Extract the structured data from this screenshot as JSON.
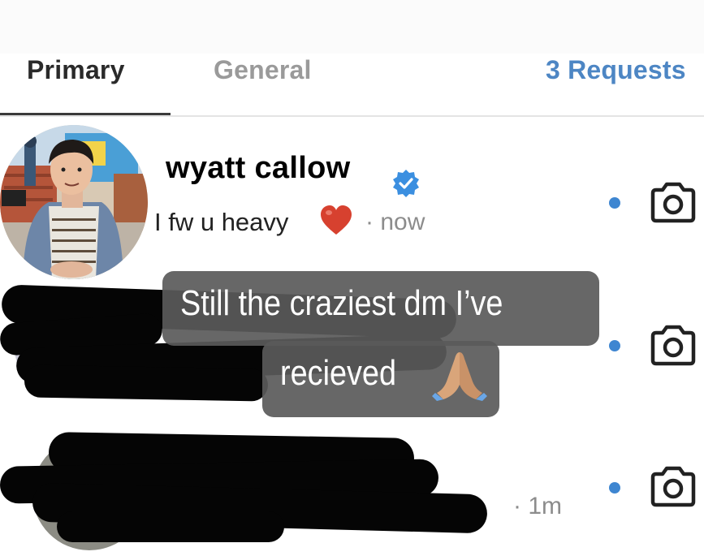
{
  "tabs": {
    "primary": "Primary",
    "general": "General",
    "requests": "3 Requests"
  },
  "threads": [
    {
      "name": "wyatt callow",
      "verified": true,
      "message": "I fw u heavy",
      "emoji": "red-heart",
      "time": "· now",
      "unread": true
    },
    {
      "name": "",
      "message": "",
      "time": "",
      "unread": true
    },
    {
      "name": "",
      "message": "",
      "time": "· 1m",
      "unread": true
    }
  ],
  "caption": {
    "line1": "Still the craziest dm I’ve",
    "line2": "recieved",
    "emoji": "folded-hands"
  },
  "colors": {
    "accent": "#4d86c4",
    "unread_dot": "#3e86d1",
    "caption_bg": "#5a5a5a",
    "redaction": "#050505"
  }
}
